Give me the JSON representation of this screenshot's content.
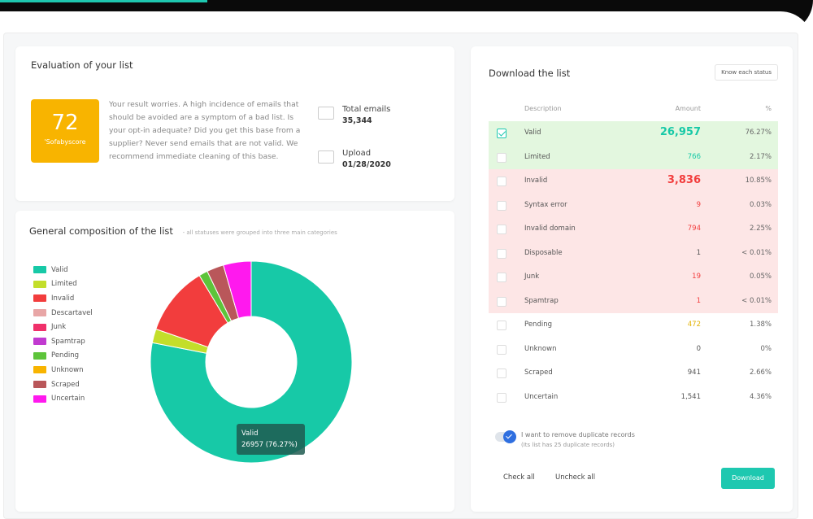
{
  "colors": {
    "accent": "#1ec8b0",
    "score_bg": "#f8b400"
  },
  "evaluation": {
    "title": "Evaluation of your list",
    "score_value": "72",
    "score_label": "'Sofabyscore",
    "description": "Your result worries. A high incidence of emails that should be avoided are a symptom of a bad list. Is your opt-in adequate? Did you get this base from a supplier? Never send emails that are not valid. We recommend immediate cleaning of this base.",
    "total_label": "Total emails",
    "total_value": "35,344",
    "upload_label": "Upload",
    "upload_value": "01/28/2020"
  },
  "composition": {
    "title": "General composition of the list",
    "subtitle": "- all statuses were grouped into three main categories",
    "legend": [
      {
        "label": "Valid",
        "color": "#17c9a7"
      },
      {
        "label": "Limited",
        "color": "#c3de2a"
      },
      {
        "label": "Invalid",
        "color": "#f23d3d"
      },
      {
        "label": "Descartavel",
        "color": "#e8a6a6"
      },
      {
        "label": "Junk",
        "color": "#f0306a"
      },
      {
        "label": "Spamtrap",
        "color": "#c13ad0"
      },
      {
        "label": "Pending",
        "color": "#5dc43a"
      },
      {
        "label": "Unknown",
        "color": "#f8b400"
      },
      {
        "label": "Scraped",
        "color": "#b9575a"
      },
      {
        "label": "Uncertain",
        "color": "#ff19ee"
      }
    ],
    "tooltip_label": "Valid",
    "tooltip_value": "26957 (76.27%)"
  },
  "chart_data": {
    "type": "pie",
    "donut": true,
    "categories": [
      "Valid",
      "Limited",
      "Invalid",
      "Pending",
      "Scraped",
      "Uncertain"
    ],
    "values": [
      76.27,
      2.17,
      10.85,
      1.38,
      2.66,
      4.36
    ],
    "colors": [
      "#17c9a7",
      "#c3de2a",
      "#f23d3d",
      "#5dc43a",
      "#b9575a",
      "#ff19ee"
    ],
    "legend_placement": "left"
  },
  "download": {
    "title": "Download the list",
    "know_button": "Know each status",
    "headers": {
      "description": "Description",
      "amount": "Amount",
      "pct": "%"
    },
    "rows": [
      {
        "desc": "Valid",
        "amount": "26,957",
        "pct": "76.27%",
        "checked": true,
        "group": "green",
        "color": "#17c9a7",
        "big": true
      },
      {
        "desc": "Limited",
        "amount": "766",
        "pct": "2.17%",
        "checked": false,
        "group": "green",
        "color": "#17c9a7",
        "big": false
      },
      {
        "desc": "Invalid",
        "amount": "3,836",
        "pct": "10.85%",
        "checked": false,
        "group": "red",
        "color": "#f23d3d",
        "big": true
      },
      {
        "desc": "Syntax error",
        "amount": "9",
        "pct": "0.03%",
        "checked": false,
        "group": "red",
        "color": "#f23d3d",
        "big": false
      },
      {
        "desc": "Invalid domain",
        "amount": "794",
        "pct": "2.25%",
        "checked": false,
        "group": "red",
        "color": "#f23d3d",
        "big": false
      },
      {
        "desc": "Disposable",
        "amount": "1",
        "pct": "< 0.01%",
        "checked": false,
        "group": "red",
        "color": "#555555",
        "big": false
      },
      {
        "desc": "Junk",
        "amount": "19",
        "pct": "0.05%",
        "checked": false,
        "group": "red",
        "color": "#f23d3d",
        "big": false
      },
      {
        "desc": "Spamtrap",
        "amount": "1",
        "pct": "< 0.01%",
        "checked": false,
        "group": "red",
        "color": "#f23d3d",
        "big": false
      },
      {
        "desc": "Pending",
        "amount": "472",
        "pct": "1.38%",
        "checked": false,
        "group": "none",
        "color": "#e2b100",
        "big": false
      },
      {
        "desc": "Unknown",
        "amount": "0",
        "pct": "0%",
        "checked": false,
        "group": "none",
        "color": "#555555",
        "big": false
      },
      {
        "desc": "Scraped",
        "amount": "941",
        "pct": "2.66%",
        "checked": false,
        "group": "none",
        "color": "#555555",
        "big": false
      },
      {
        "desc": "Uncertain",
        "amount": "1,541",
        "pct": "4.36%",
        "checked": false,
        "group": "none",
        "color": "#555555",
        "big": false
      }
    ],
    "dup_text": "I want to remove duplicate records",
    "dup_sub": "(Its list has 25 duplicate records)",
    "check_all": "Check all",
    "uncheck_all": "Uncheck all",
    "download_button": "Download"
  }
}
